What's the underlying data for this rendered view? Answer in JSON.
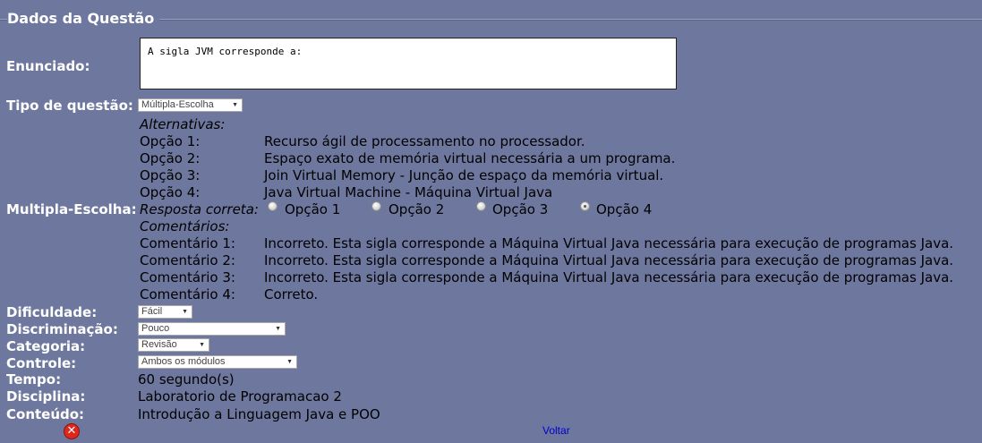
{
  "section": {
    "legend": "Dados da Questão"
  },
  "labels": {
    "enunciado": "Enunciado:",
    "tipo": "Tipo de questão:",
    "multipla": "Multipla-Escolha:",
    "dificuldade": "Dificuldade:",
    "discriminacao": "Discriminação:",
    "categoria": "Categoria:",
    "controle": "Controle:",
    "tempo": "Tempo:",
    "disciplina": "Disciplina:",
    "conteudo": "Conteúdo:"
  },
  "enunciado_text": "A sigla JVM corresponde a:",
  "tipo_select": {
    "value": "Múltipla-Escolha"
  },
  "alternativas": {
    "heading": "Alternativas:",
    "items": [
      {
        "label": "Opção 1:",
        "text": "Recurso ágil de processamento no processador."
      },
      {
        "label": "Opção 2:",
        "text": "Espaço exato de memória virtual necessária a um programa."
      },
      {
        "label": "Opção 3:",
        "text": "Join Virtual Memory - Junção de espaço da memória virtual."
      },
      {
        "label": "Opção 4:",
        "text": "Java Virtual Machine - Máquina Virtual Java"
      }
    ]
  },
  "resposta": {
    "heading": "Resposta correta:",
    "options": [
      "Opção 1",
      "Opção 2",
      "Opção 3",
      "Opção 4"
    ],
    "selected": "Opção 4"
  },
  "comentarios": {
    "heading": "Comentários:",
    "items": [
      {
        "label": "Comentário 1:",
        "text": "Incorreto. Esta sigla corresponde a Máquina Virtual Java necessária para execução de programas Java."
      },
      {
        "label": "Comentário 2:",
        "text": "Incorreto. Esta sigla corresponde a Máquina Virtual Java necessária para execução de programas Java."
      },
      {
        "label": "Comentário 3:",
        "text": "Incorreto. Esta sigla corresponde a Máquina Virtual Java necessária para execução de programas Java."
      },
      {
        "label": "Comentário 4:",
        "text": "Correto."
      }
    ]
  },
  "dificuldade_select": {
    "value": "Fácil"
  },
  "discriminacao_select": {
    "value": "Pouco"
  },
  "categoria_select": {
    "value": "Revisão"
  },
  "controle_select": {
    "value": "Ambos os módulos"
  },
  "tempo_value": "60 segundo(s)",
  "disciplina_value": "Laboratorio de Programacao 2",
  "conteudo_value": "Introdução a Linguagem Java e POO",
  "actions": {
    "voltar": "Voltar",
    "delete_icon": "close-icon"
  },
  "colors": {
    "background": "#6e789e",
    "label": "#ffffff",
    "link": "#0000cc",
    "delete": "#e0271c"
  }
}
